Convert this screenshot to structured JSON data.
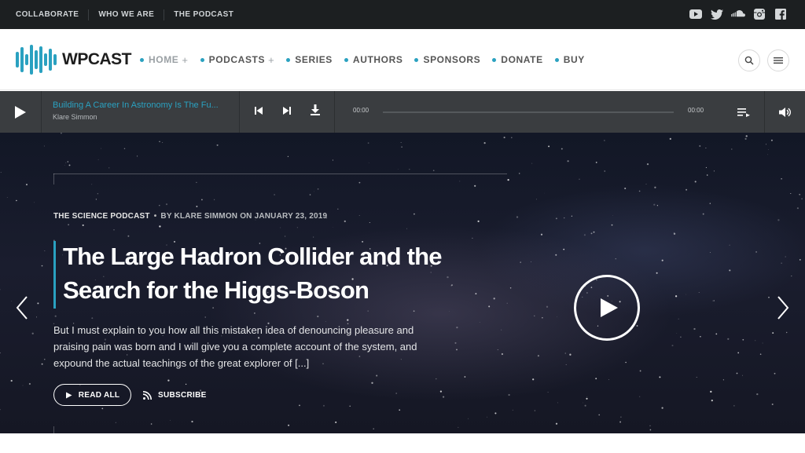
{
  "topbar": {
    "links": [
      "COLLABORATE",
      "WHO WE ARE",
      "THE PODCAST"
    ],
    "social_icons": [
      "youtube-icon",
      "twitter-icon",
      "soundcloud-icon",
      "instagram-icon",
      "facebook-icon"
    ]
  },
  "header": {
    "logo_text": "WPCAST",
    "nav": [
      {
        "label": "HOME",
        "has_submenu": true,
        "active": true
      },
      {
        "label": "PODCASTS",
        "has_submenu": true,
        "active": false
      },
      {
        "label": "SERIES",
        "has_submenu": false,
        "active": false
      },
      {
        "label": "AUTHORS",
        "has_submenu": false,
        "active": false
      },
      {
        "label": "SPONSORS",
        "has_submenu": false,
        "active": false
      },
      {
        "label": "DONATE",
        "has_submenu": false,
        "active": false
      },
      {
        "label": "BUY",
        "has_submenu": false,
        "active": false
      }
    ],
    "submenu_marker": "+"
  },
  "player": {
    "track_title": "Building A Career In Astronomy Is The Fu...",
    "track_author": "Klare Simmon",
    "current_time": "00:00",
    "total_time": "00:00",
    "progress": 0
  },
  "hero": {
    "category": "THE SCIENCE PODCAST",
    "separator": "•",
    "byline": "BY KLARE SIMMON ON JANUARY 23, 2019",
    "title": "The Large Hadron Collider and the Search for the Higgs-Boson",
    "excerpt": "But I must explain to you how all this mistaken idea of denouncing pleasure and praising pain was born and I will give you a complete account of the system, and expound the actual teachings of the great explorer of [...]",
    "read_all_label": "READ ALL",
    "subscribe_label": "SUBSCRIBE"
  },
  "colors": {
    "accent": "#2aa1c0",
    "topbar_bg": "#1c1f21",
    "player_bg": "#3a3d40"
  }
}
